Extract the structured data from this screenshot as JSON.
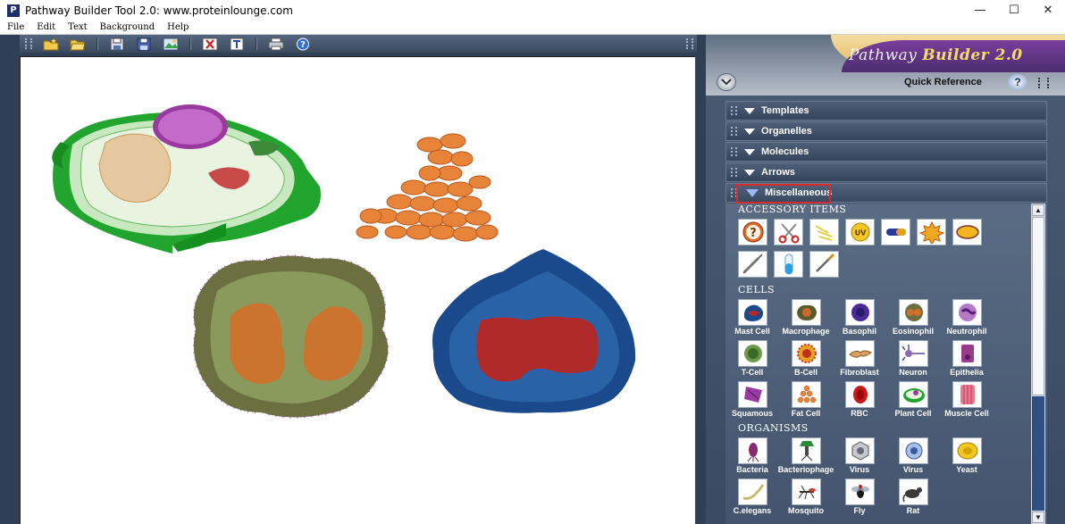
{
  "window": {
    "title": "Pathway Builder Tool 2.0: www.proteinlounge.com",
    "app_icon": "P",
    "controls": {
      "minimize": "—",
      "maximize": "☐",
      "close": "✕"
    }
  },
  "menu": [
    "File",
    "Edit",
    "Text",
    "Background",
    "Help"
  ],
  "toolbar": {
    "icons": [
      "new-file-icon",
      "open-folder-icon",
      "save-icon",
      "save-as-icon",
      "export-image-icon",
      "delete-icon",
      "text-icon",
      "print-icon",
      "help-icon"
    ]
  },
  "panel": {
    "logo_main": "Pathway ",
    "logo_accent": "Builder 2.0",
    "quick_reference": "Quick Reference",
    "help_glyph": "?",
    "sections": [
      "Templates",
      "Organelles",
      "Molecules",
      "Arrows",
      "Miscellaneous"
    ],
    "active_section": "Miscellaneous"
  },
  "library": {
    "accessory_title": "ACCESSORY ITEMS",
    "accessory_items": [
      "question-icon",
      "scissors-icon",
      "lightning-icon",
      "uv-icon",
      "pill-icon",
      "starburst-icon",
      "oval-icon",
      "syringe-icon",
      "test-tube-icon",
      "pipette-icon"
    ],
    "uv_text": "UV",
    "cells_title": "CELLS",
    "cells": [
      "Mast Cell",
      "Macrophage",
      "Basophil",
      "Eosinophil",
      "Neutrophil",
      "T-Cell",
      "B-Cell",
      "Fibroblast",
      "Neuron",
      "Epithelia",
      "Squamous",
      "Fat Cell",
      "RBC",
      "Plant Cell",
      "Muscle Cell"
    ],
    "organisms_title": "ORGANISMS",
    "organisms": [
      "Bacteria",
      "Bacteriophage",
      "Virus",
      "Virus",
      "Yeast",
      "C.elegans",
      "Mosquito",
      "Fly",
      "Rat"
    ]
  },
  "canvas": {
    "objects": [
      "plant-cell-drawing",
      "fat-cell-cluster-drawing",
      "eosinophil-cell-drawing",
      "mast-cell-drawing"
    ]
  },
  "colors": {
    "panel_bg": "#44546e",
    "highlight_outline": "#d82a2a",
    "plant_green": "#2fb53a",
    "fat_orange": "#e8843a",
    "mast_blue": "#1a4a8c"
  }
}
